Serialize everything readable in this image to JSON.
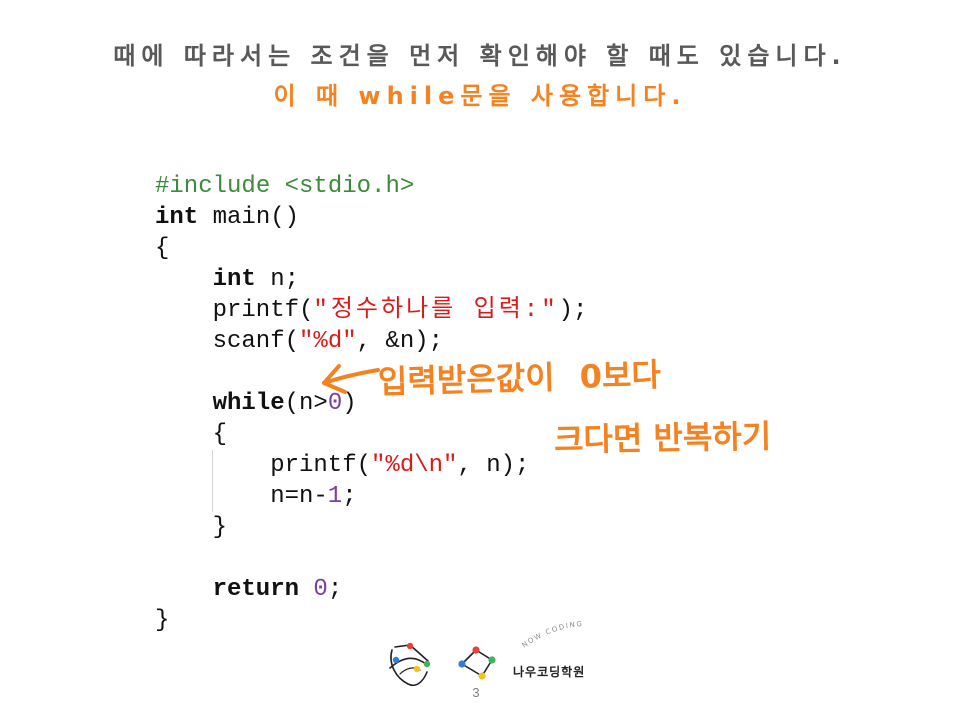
{
  "slide": {
    "title_line1": "때에 따라서는 조건을 먼저 확인해야 할 때도 있습니다.",
    "title_line2": "이 때 while문을 사용합니다.",
    "page_number": "3"
  },
  "code": {
    "lines": [
      [
        "#include <stdio.h>"
      ],
      [
        "int",
        " main()"
      ],
      [
        "{"
      ],
      [
        "int",
        " n;"
      ],
      [
        "printf(",
        "\"정수하나를 입력:\"",
        ");"
      ],
      [
        "scanf(",
        "\"%d\"",
        ", &n);"
      ],
      [],
      [
        "while",
        "(n>",
        "0",
        ")"
      ],
      [
        "{"
      ],
      [
        "printf(",
        "\"%d\\n\"",
        ", n);"
      ],
      [
        "n=n-",
        "1",
        ";"
      ],
      [
        "}"
      ],
      [],
      [
        "return",
        " ",
        "0",
        ";"
      ],
      [
        "}"
      ]
    ]
  },
  "annotation": {
    "line1": "입력받은값이 0보다",
    "line2": "크다면 반복하기"
  },
  "footer": {
    "brand_arc": "NOW CODING",
    "brand_name": "나우코딩학원"
  },
  "icons": {
    "annotation_arrow": "arrow-left-icon",
    "logo_left": "hand-drawn-logo-icon",
    "logo_right": "network-diamond-logo-icon"
  },
  "colors": {
    "title": "#595959",
    "accent": "#F58220",
    "preprocessor": "#3B8B3B",
    "string": "#D81B1B",
    "number": "#7B3FA0",
    "keyword": "#111111",
    "text": "#111111",
    "page_number": "#7F7F7F"
  }
}
